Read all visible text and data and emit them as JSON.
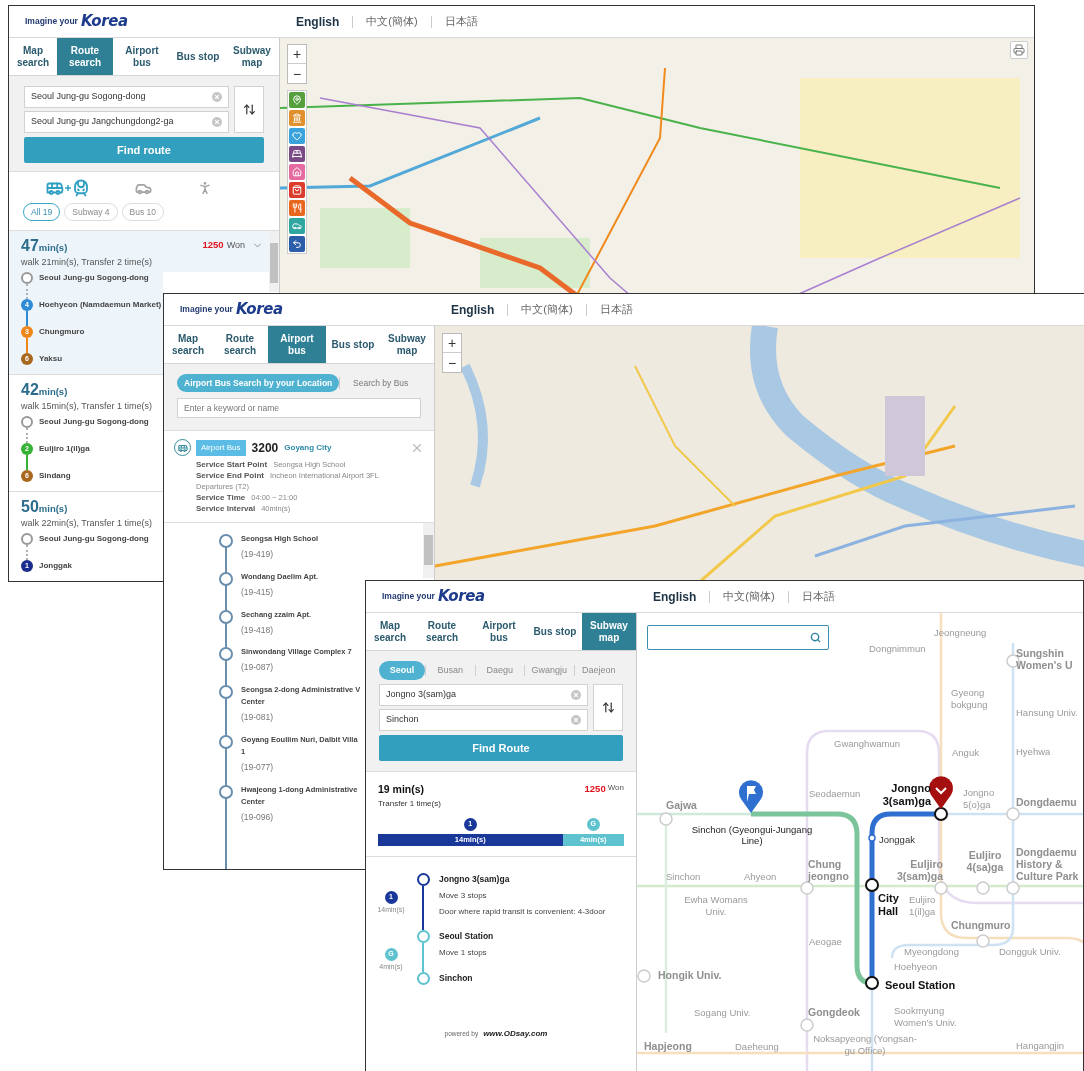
{
  "windows": [
    {
      "kind": "route_search",
      "header": {
        "logo_prefix": "Imagine your",
        "logo": "Korea",
        "languages": [
          {
            "label": "English",
            "selected": true
          },
          {
            "label": "中文(簡体)",
            "selected": false
          },
          {
            "label": "日本語",
            "selected": false
          }
        ]
      },
      "tabs": [
        {
          "label": "Map search",
          "selected": false
        },
        {
          "label": "Route search",
          "selected": true
        },
        {
          "label": "Airport bus",
          "selected": false
        },
        {
          "label": "Bus stop",
          "selected": false
        },
        {
          "label": "Subway map",
          "selected": false
        }
      ],
      "origin": "Seoul Jung-gu Sogong-dong",
      "destination": "Seoul Jung-gu Jangchungdong2-ga",
      "find_button": "Find route",
      "modes": [
        {
          "kind": "transit",
          "selected": true
        },
        {
          "kind": "car",
          "selected": false
        },
        {
          "kind": "walk",
          "selected": false
        }
      ],
      "filters": [
        {
          "label": "All 19",
          "selected": true
        },
        {
          "label": "Subway 4",
          "selected": false
        },
        {
          "label": "Bus 10",
          "selected": false
        }
      ],
      "routes": [
        {
          "time": "47",
          "unit": "min(s)",
          "fare": "1250",
          "currency": "Won",
          "summary": "walk 21min(s), Transfer 2 time(s)",
          "selected": true,
          "stops": [
            {
              "kind": "start",
              "name": "Seoul Jung-gu Sogong-dong"
            },
            {
              "kind": "line",
              "line": "4",
              "color": "#2f8bd6",
              "name": "Hoehyeon (Namdaemun Market)"
            },
            {
              "kind": "line",
              "line": "3",
              "color": "#f0861a",
              "name": "Chungmuro"
            },
            {
              "kind": "line",
              "line": "6",
              "color": "#a8691e",
              "name": "Yaksu"
            }
          ]
        },
        {
          "time": "42",
          "unit": "min(s)",
          "summary": "walk 15min(s), Transfer 1 time(s)",
          "selected": false,
          "stops": [
            {
              "kind": "start",
              "name": "Seoul Jung-gu Sogong-dong"
            },
            {
              "kind": "line",
              "line": "2",
              "color": "#34b334",
              "name": "Euljiro 1(il)ga"
            },
            {
              "kind": "line",
              "line": "6",
              "color": "#a8691e",
              "name": "Sindang"
            }
          ]
        },
        {
          "time": "50",
          "unit": "min(s)",
          "summary": "walk 22min(s), Transfer 1 time(s)",
          "selected": false,
          "stops": [
            {
              "kind": "start",
              "name": "Seoul Jung-gu Sogong-dong"
            },
            {
              "kind": "line",
              "line": "1",
              "color": "#1a2f8c",
              "name": "Jonggak"
            }
          ]
        }
      ],
      "map": {
        "zoom_in": "+",
        "zoom_out": "−",
        "categories": [
          {
            "kind": "pin",
            "color": "#55a03c"
          },
          {
            "kind": "landmark",
            "color": "#e0902c"
          },
          {
            "kind": "heart",
            "color": "#3ba3db"
          },
          {
            "kind": "bed",
            "color": "#7a4a86"
          },
          {
            "kind": "house",
            "color": "#e46aa0"
          },
          {
            "kind": "bag",
            "color": "#dc3c2c"
          },
          {
            "kind": "utensils",
            "color": "#e8661e"
          },
          {
            "kind": "car",
            "color": "#2fa6a0"
          },
          {
            "kind": "return",
            "color": "#2a5ea8"
          }
        ]
      }
    },
    {
      "kind": "airport_bus",
      "header": {
        "logo_prefix": "Imagine your",
        "logo": "Korea",
        "languages": [
          {
            "label": "English",
            "selected": true
          },
          {
            "label": "中文(簡体)",
            "selected": false
          },
          {
            "label": "日本語",
            "selected": false
          }
        ]
      },
      "tabs": [
        {
          "label": "Map search",
          "selected": false
        },
        {
          "label": "Route search",
          "selected": false
        },
        {
          "label": "Airport bus",
          "selected": true
        },
        {
          "label": "Bus stop",
          "selected": false
        },
        {
          "label": "Subway map",
          "selected": false
        }
      ],
      "search_modes": [
        {
          "label": "Airport Bus Search by your Location",
          "selected": true
        },
        {
          "label": "Search by Bus",
          "selected": false
        }
      ],
      "search": {
        "placeholder": "Enter a keyword or name"
      },
      "bus": {
        "badge": "Airport Bus",
        "number": "3200",
        "city": "Goyang City",
        "details": [
          {
            "label": "Service Start Point",
            "value": "Seongsa High School"
          },
          {
            "label": "Service End Point",
            "value": "Incheon International Airport 3FL Departures (T2)"
          },
          {
            "label": "Service Time",
            "value": "04:00 ~ 21:00"
          },
          {
            "label": "Service Interval",
            "value": "40min(s)"
          }
        ]
      },
      "stops": [
        {
          "name_lines": [
            "Seongsa High School"
          ],
          "code": "(19-419)"
        },
        {
          "name_lines": [
            "Wondang Daelim Apt."
          ],
          "code": "(19-415)"
        },
        {
          "name_lines": [
            "Sechang zzaim Apt."
          ],
          "code": "(19-418)"
        },
        {
          "name_lines": [
            "Sinwondang Village Complex 7"
          ],
          "code": "(19-087)"
        },
        {
          "name_lines": [
            "Seongsa 2-dong Administrative V",
            "Center"
          ],
          "code": "(19-081)"
        },
        {
          "name_lines": [
            "Goyang Eoullim Nuri, Dalbit Villa",
            "1"
          ],
          "code": "(19-077)"
        },
        {
          "name_lines": [
            "Hwajeong 1-dong Administrative",
            "Center"
          ],
          "code": "(19-096)"
        }
      ],
      "map": {
        "zoom_in": "+",
        "zoom_out": "−"
      }
    },
    {
      "kind": "subway",
      "header": {
        "logo_prefix": "Imagine your",
        "logo": "Korea",
        "languages": [
          {
            "label": "English",
            "selected": true
          },
          {
            "label": "中文(簡体)",
            "selected": false
          },
          {
            "label": "日本語",
            "selected": false
          }
        ]
      },
      "tabs": [
        {
          "label": "Map search",
          "selected": false
        },
        {
          "label": "Route search",
          "selected": false
        },
        {
          "label": "Airport bus",
          "selected": false
        },
        {
          "label": "Bus stop",
          "selected": false
        },
        {
          "label": "Subway map",
          "selected": true
        }
      ],
      "cities": [
        {
          "label": "Seoul",
          "selected": true
        },
        {
          "label": "Busan",
          "selected": false
        },
        {
          "label": "Daegu",
          "selected": false
        },
        {
          "label": "Gwangju",
          "selected": false
        },
        {
          "label": "Daejeon",
          "selected": false
        }
      ],
      "origin": "Jongno 3(sam)ga",
      "destination": "Sinchon",
      "find_button": "Find Route",
      "result": {
        "time": "19 min(s)",
        "fare": "1250",
        "currency": "Won",
        "transfers": "Transfer 1 time(s)",
        "segments": [
          {
            "line": "1",
            "color": "#1a379a",
            "duration": "14min(s)",
            "level": 0.75
          },
          {
            "line": "G",
            "color": "#5ec3cf",
            "duration": "4min(s)",
            "level": 0.25
          }
        ]
      },
      "steps": [
        {
          "station": "Jongno 3(sam)ga",
          "notes": [
            "Move 3 stops",
            "Door where rapid transit is convenient: 4-3door"
          ],
          "line": "1",
          "color": "#1a379a",
          "duration": "14min(s)"
        },
        {
          "station": "Seoul Station",
          "notes": [
            "Move 1 stops"
          ],
          "line": "G",
          "color": "#5ec3cf",
          "duration": "4min(s)"
        },
        {
          "station": "Sinchon"
        }
      ],
      "footer": {
        "powered_by": "powered by",
        "site": "www.ODsay.com"
      },
      "subway_map": {
        "route_stations": [
          {
            "kind": "origin",
            "name": "Sinchon (Gyeongui-Jungang Line)"
          },
          {
            "kind": "destination",
            "name": "Jongno 3(sam)ga"
          },
          {
            "kind": "minor",
            "name": "Jonggak"
          },
          {
            "kind": "transfer",
            "name": "City Hall"
          },
          {
            "kind": "transfer",
            "name": "Seoul Station"
          }
        ],
        "other_stations": [
          {
            "kind": "minor",
            "name": "Jeongneung"
          },
          {
            "kind": "minor",
            "name": "Dongnimmun"
          },
          {
            "kind": "major",
            "name": "Sungshin Women's U"
          },
          {
            "kind": "minor",
            "name": "Gyeong bokgung"
          },
          {
            "kind": "minor",
            "name": "Hansung Univ."
          },
          {
            "kind": "minor",
            "name": "Gwanghwamun"
          },
          {
            "kind": "minor",
            "name": "Anguk"
          },
          {
            "kind": "minor",
            "name": "Hyehwa"
          },
          {
            "kind": "major",
            "name": "Gajwa"
          },
          {
            "kind": "minor",
            "name": "Seodaemun"
          },
          {
            "kind": "minor",
            "name": "Jongno 5(o)ga"
          },
          {
            "kind": "major",
            "name": "Dongdaemu"
          },
          {
            "kind": "minor",
            "name": "Sinchon"
          },
          {
            "kind": "minor",
            "name": "Ahyeon"
          },
          {
            "kind": "major",
            "name": "Chung jeongno"
          },
          {
            "kind": "major",
            "name": "Euljiro 3(sam)ga"
          },
          {
            "kind": "major",
            "name": "Euljiro 4(sa)ga"
          },
          {
            "kind": "major",
            "name": "Dongdaemu History & Culture Park"
          },
          {
            "kind": "minor",
            "name": "Ewha Womans Univ."
          },
          {
            "kind": "minor",
            "name": "Euljiro 1(il)ga"
          },
          {
            "kind": "major",
            "name": "Chungmuro"
          },
          {
            "kind": "minor",
            "name": "Aeogae"
          },
          {
            "kind": "minor",
            "name": "Myeongdong"
          },
          {
            "kind": "minor",
            "name": "Dongguk Univ."
          },
          {
            "kind": "major",
            "name": "Hongik Univ."
          },
          {
            "kind": "minor",
            "name": "Hoehyeon"
          },
          {
            "kind": "minor",
            "name": "Sogang Univ."
          },
          {
            "kind": "major",
            "name": "Gongdeok"
          },
          {
            "kind": "minor",
            "name": "Sookmyung Women's Univ."
          },
          {
            "kind": "major",
            "name": "Hapjeong"
          },
          {
            "kind": "minor",
            "name": "Daeheung"
          },
          {
            "kind": "minor",
            "name": "Noksapyeong (Yongsan-gu Office)"
          },
          {
            "kind": "minor",
            "name": "Hangangjin"
          }
        ]
      }
    }
  ]
}
